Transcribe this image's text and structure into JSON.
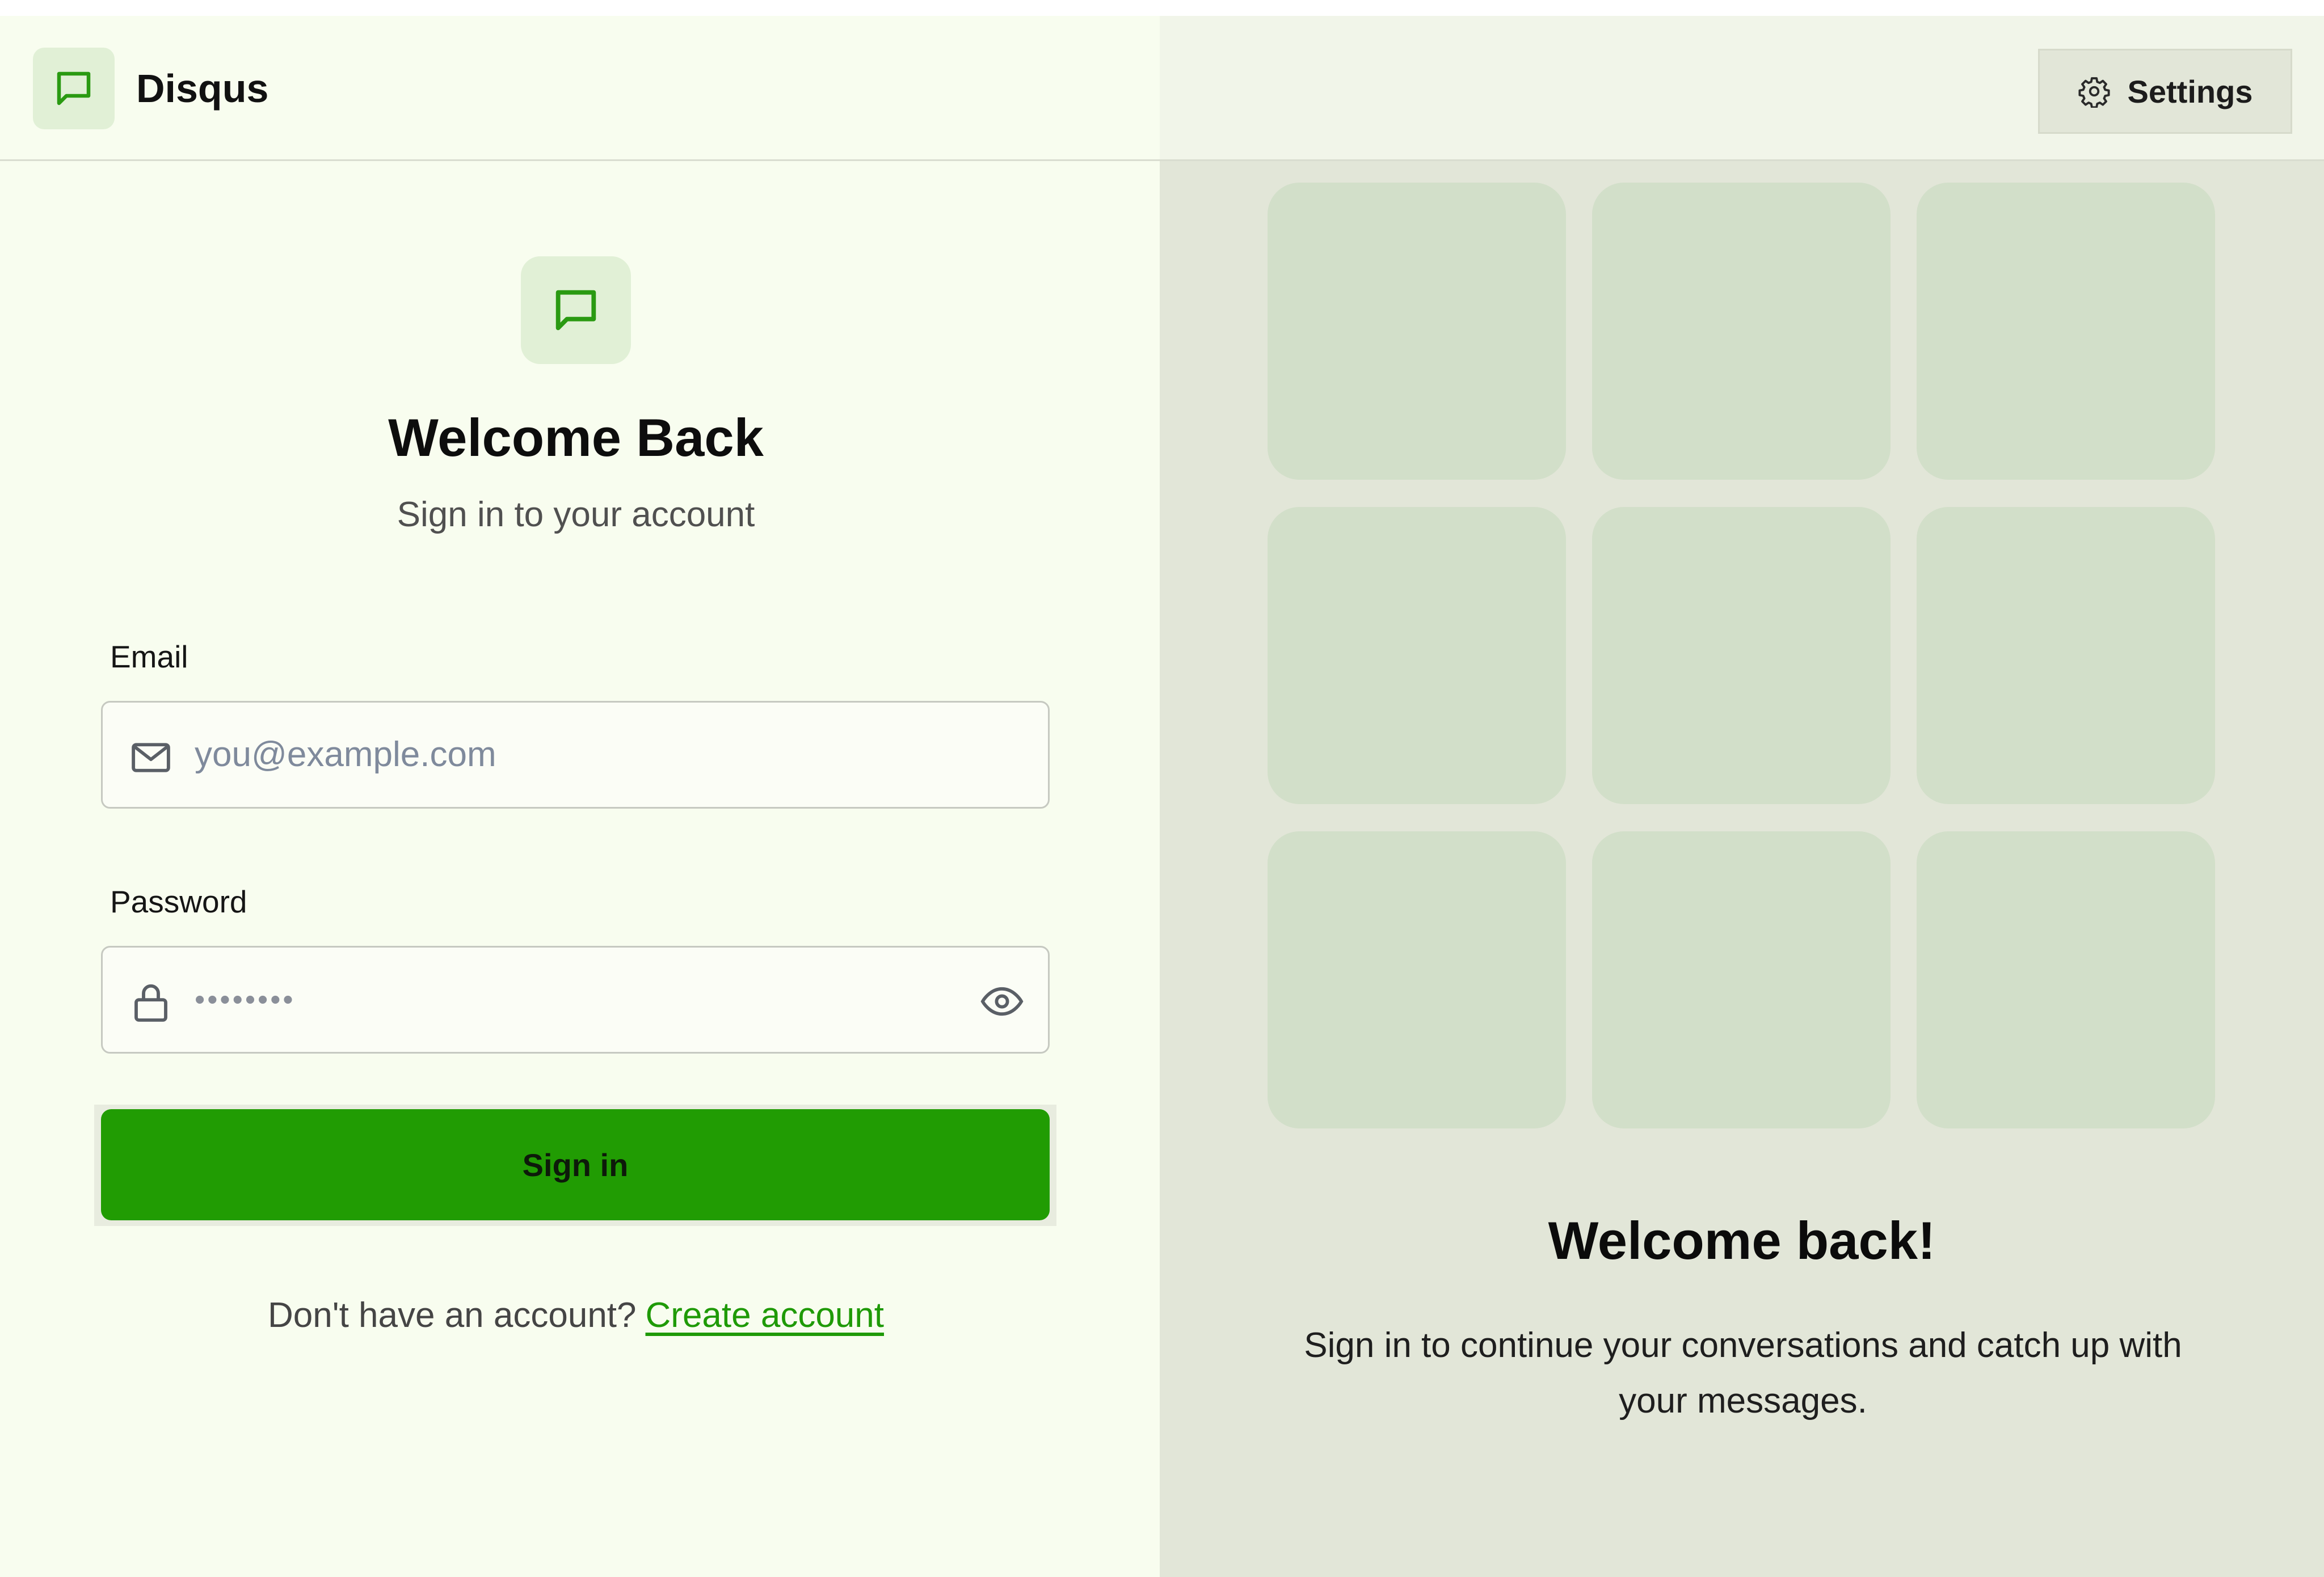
{
  "brand": {
    "name": "Disqus",
    "icon": "chat-bubble-icon",
    "accent_color": "#219c03"
  },
  "header": {
    "settings_label": "Settings",
    "settings_icon": "gear-icon"
  },
  "login": {
    "title": "Welcome Back",
    "subtitle": "Sign in to your account",
    "email": {
      "label": "Email",
      "placeholder": "you@example.com",
      "icon": "mail-icon"
    },
    "password": {
      "label": "Password",
      "value": "••••••••",
      "icon": "lock-icon",
      "toggle_icon": "eye-icon"
    },
    "submit_label": "Sign in",
    "footer_prompt": "Don't have an account?",
    "footer_link": "Create account"
  },
  "promo": {
    "title": "Welcome back!",
    "text": "Sign in to continue your conversations and catch up with your messages."
  }
}
